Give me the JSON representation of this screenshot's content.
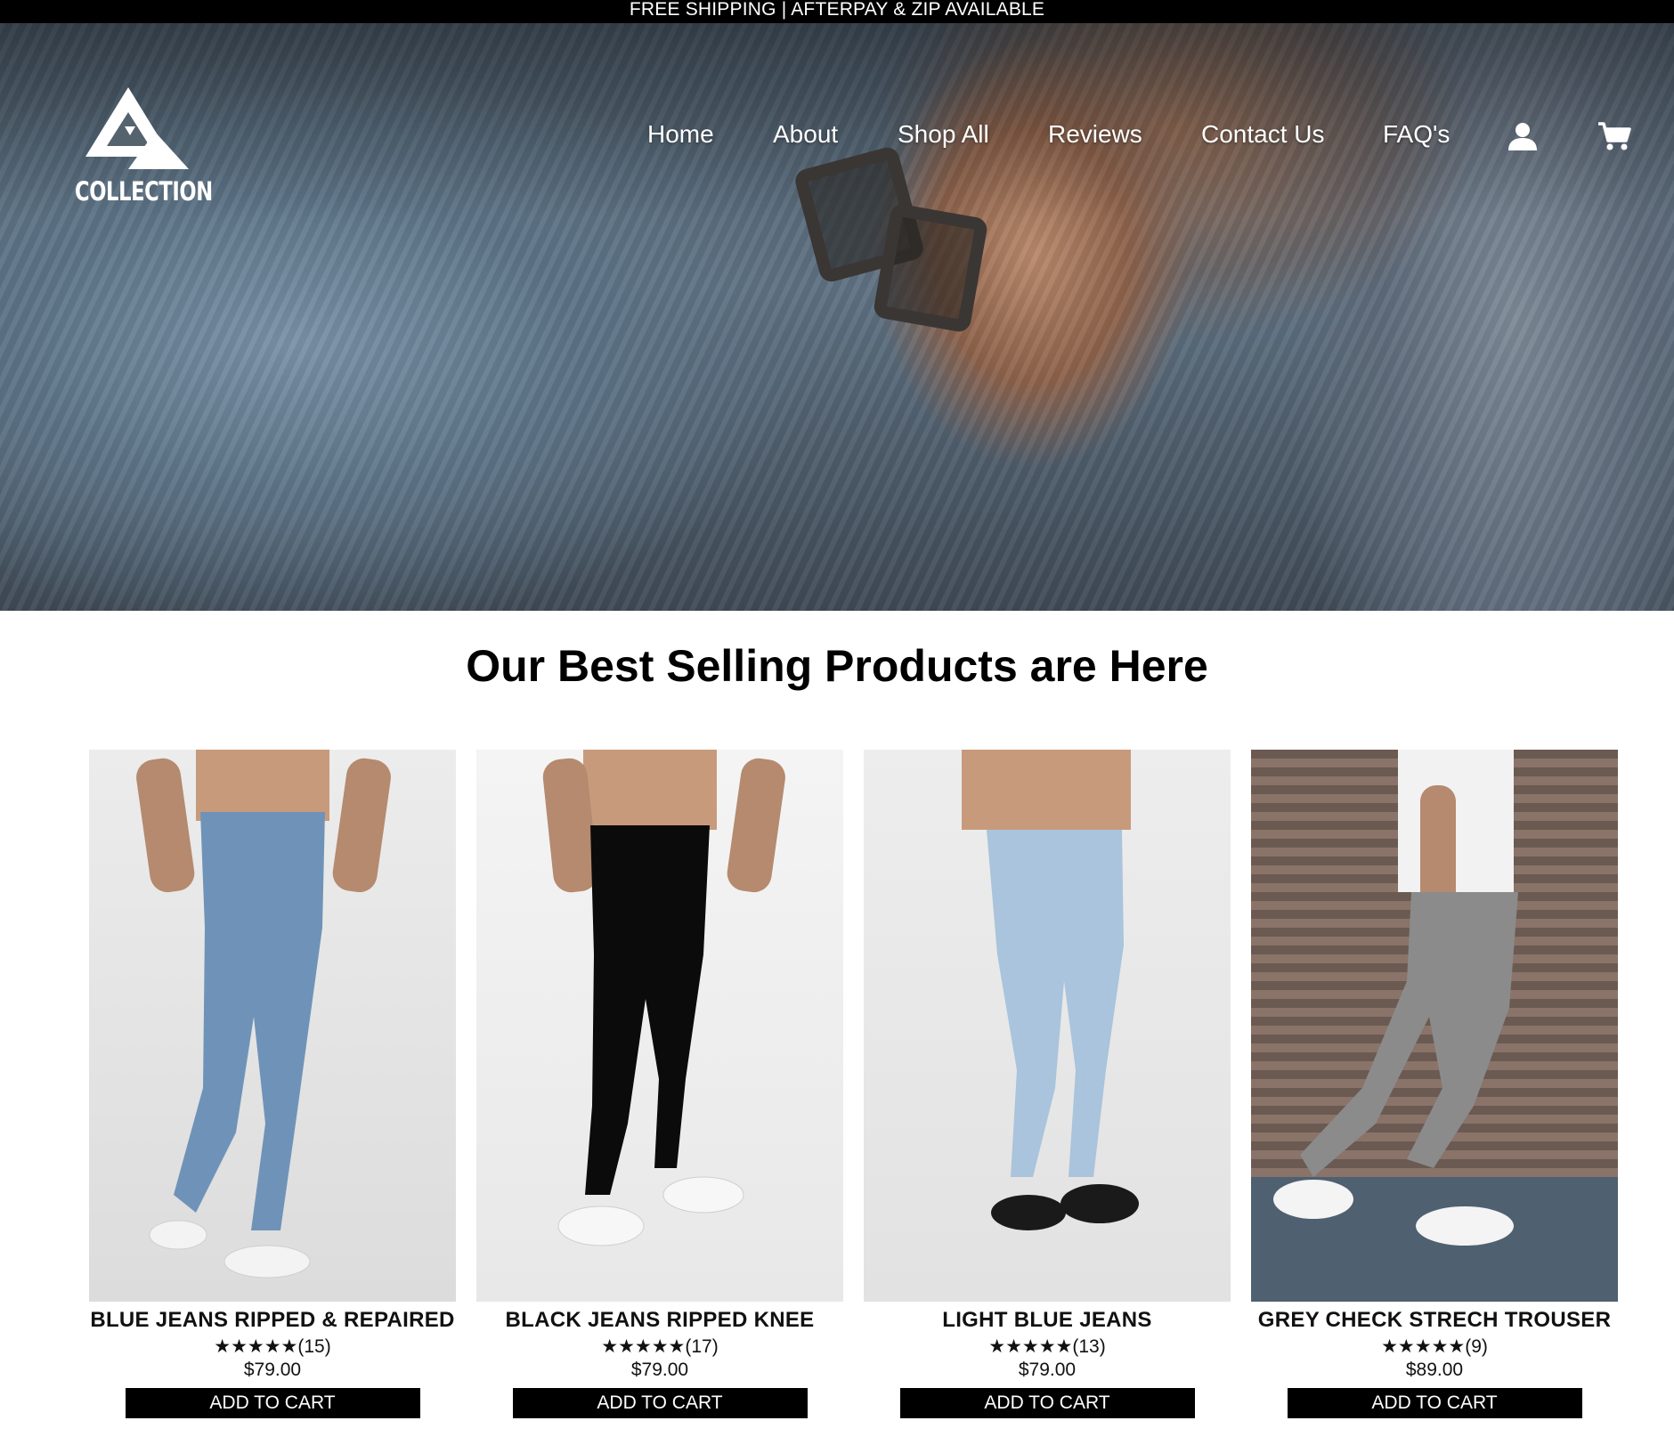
{
  "announcement": "FREE SHIPPING | AFTERPAY & ZIP AVAILABLE",
  "brand": {
    "logo_text": "COLLECTION"
  },
  "nav": {
    "items": [
      "Home",
      "About",
      "Shop All",
      "Reviews",
      "Contact Us",
      "FAQ's"
    ],
    "icons": [
      "user-icon",
      "cart-icon"
    ]
  },
  "section_title": "Our Best Selling Products are Here",
  "products": [
    {
      "name": "BLUE JEANS RIPPED & REPAIRED",
      "rating": "★★★★★(15)",
      "price": "$79.00",
      "button": "ADD TO CART",
      "color": "#6f93b8"
    },
    {
      "name": "BLACK JEANS RIPPED KNEE",
      "rating": "★★★★★(17)",
      "price": "$79.00",
      "button": "ADD TO CART",
      "color": "#0b0b0b"
    },
    {
      "name": "LIGHT BLUE JEANS",
      "rating": "★★★★★(13)",
      "price": "$79.00",
      "button": "ADD TO CART",
      "color": "#a9c4dc"
    },
    {
      "name": "GREY CHECK STRECH TROUSER",
      "rating": "★★★★★(9)",
      "price": "$89.00",
      "button": "ADD TO CART",
      "color": "#8b8b8b"
    }
  ],
  "colors": {
    "topbar": "#000000",
    "button": "#000000",
    "text": "#000000"
  }
}
